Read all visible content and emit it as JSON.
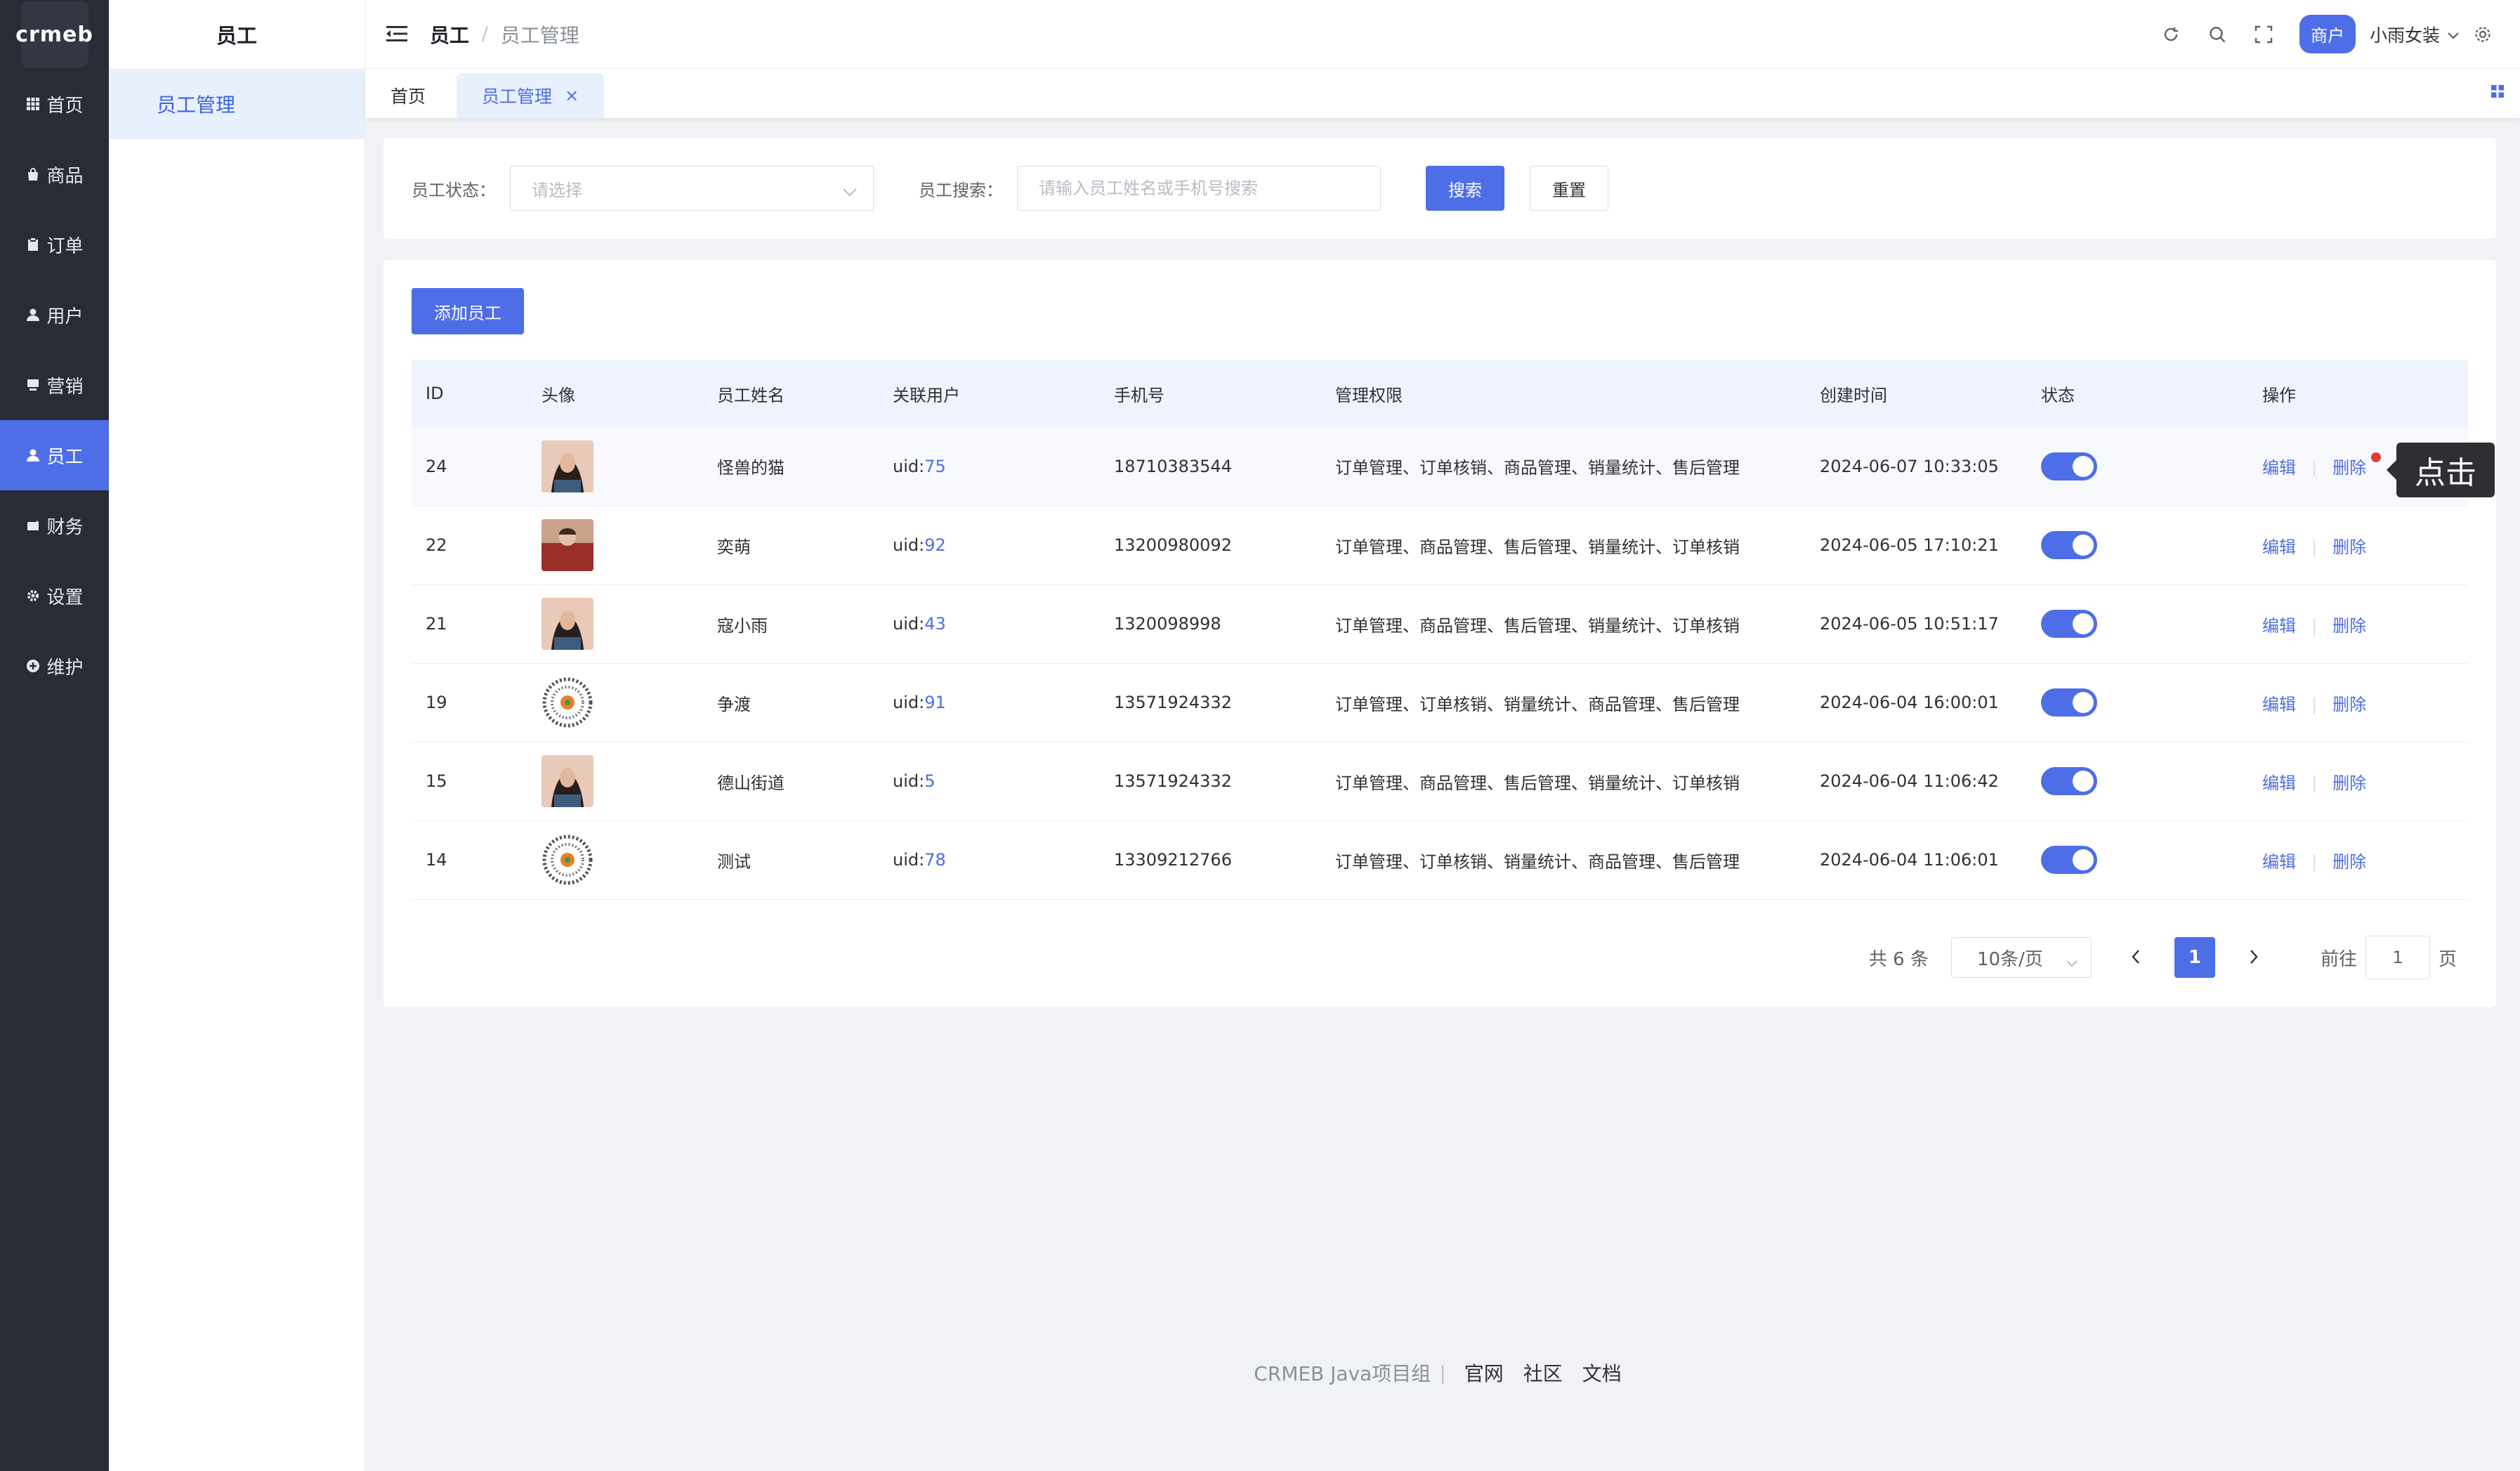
{
  "brand": {
    "logo_text": "crmeb"
  },
  "nav": {
    "items": [
      {
        "label": "首页",
        "icon": "grid-icon"
      },
      {
        "label": "商品",
        "icon": "bag-icon"
      },
      {
        "label": "订单",
        "icon": "clipboard-icon"
      },
      {
        "label": "用户",
        "icon": "user-icon"
      },
      {
        "label": "营销",
        "icon": "monitor-icon"
      },
      {
        "label": "员工",
        "icon": "user-icon",
        "active": true
      },
      {
        "label": "财务",
        "icon": "wallet-icon"
      },
      {
        "label": "设置",
        "icon": "gear-icon"
      },
      {
        "label": "维护",
        "icon": "plus-circle-icon"
      }
    ]
  },
  "subnav": {
    "title": "员工",
    "items": [
      {
        "label": "员工管理",
        "active": true
      }
    ]
  },
  "header": {
    "crumb_parent": "员工",
    "crumb_sep": "/",
    "crumb_current": "员工管理",
    "badge": "商户",
    "user_name": "小雨女装"
  },
  "tabs": [
    {
      "label": "首页",
      "active": false
    },
    {
      "label": "员工管理",
      "active": true,
      "close": "×"
    }
  ],
  "filter": {
    "status_label": "员工状态：",
    "status_placeholder": "请选择",
    "search_label": "员工搜索：",
    "search_placeholder": "请输入员工姓名或手机号搜索",
    "search_button": "搜索",
    "reset_button": "重置"
  },
  "table": {
    "add_button": "添加员工",
    "columns": [
      "ID",
      "头像",
      "员工姓名",
      "关联用户",
      "手机号",
      "管理权限",
      "创建时间",
      "状态",
      "操作"
    ],
    "uid_prefix": "uid:",
    "edit_label": "编辑",
    "delete_label": "删除",
    "rows": [
      {
        "id": "24",
        "avatar": "portrait-woman",
        "name": "怪兽的猫",
        "uid": "75",
        "phone": "18710383544",
        "permissions": "订单管理、订单核销、商品管理、销量统计、售后管理",
        "created": "2024-06-07 10:33:05",
        "enabled": true
      },
      {
        "id": "22",
        "avatar": "portrait-red",
        "name": "奕萌",
        "uid": "92",
        "phone": "13200980092",
        "permissions": "订单管理、商品管理、售后管理、销量统计、订单核销",
        "created": "2024-06-05 17:10:21",
        "enabled": true
      },
      {
        "id": "21",
        "avatar": "portrait-woman",
        "name": "寇小雨",
        "uid": "43",
        "phone": "1320098998",
        "permissions": "订单管理、商品管理、售后管理、销量统计、订单核销",
        "created": "2024-06-05 10:51:17",
        "enabled": true
      },
      {
        "id": "19",
        "avatar": "qr-code",
        "name": "争渡",
        "uid": "91",
        "phone": "13571924332",
        "permissions": "订单管理、订单核销、销量统计、商品管理、售后管理",
        "created": "2024-06-04 16:00:01",
        "enabled": true
      },
      {
        "id": "15",
        "avatar": "portrait-woman",
        "name": "德山街道",
        "uid": "5",
        "phone": "13571924332",
        "permissions": "订单管理、商品管理、售后管理、销量统计、订单核销",
        "created": "2024-06-04 11:06:42",
        "enabled": true
      },
      {
        "id": "14",
        "avatar": "qr-code",
        "name": "测试",
        "uid": "78",
        "phone": "13309212766",
        "permissions": "订单管理、订单核销、销量统计、商品管理、售后管理",
        "created": "2024-06-04 11:06:01",
        "enabled": true
      }
    ]
  },
  "tooltip": {
    "text": "点击"
  },
  "pagination": {
    "total": "共 6 条",
    "page_size": "10条/页",
    "current_page": "1",
    "goto_label": "前往",
    "goto_value": "1",
    "page_suffix": "页"
  },
  "footer": {
    "group": "CRMEB Java项目组",
    "links": [
      "官网",
      "社区",
      "文档"
    ]
  },
  "colors": {
    "accent": "#4d6ee6",
    "sidebar": "#282c34",
    "tooltip": "#2d2f33"
  }
}
